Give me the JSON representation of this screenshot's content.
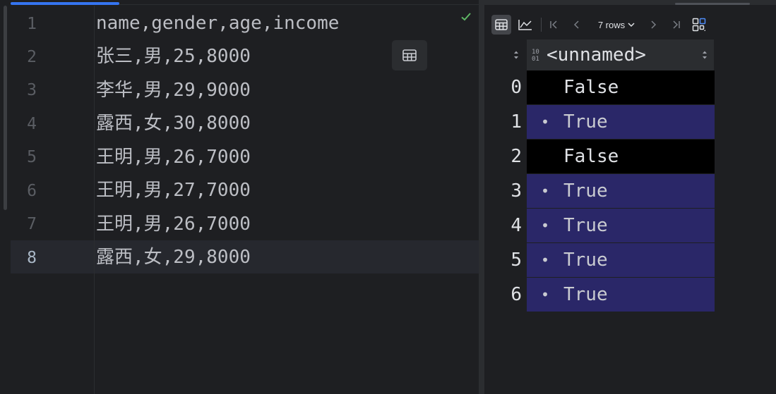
{
  "editor": {
    "line_numbers": [
      "1",
      "2",
      "3",
      "4",
      "5",
      "6",
      "7",
      "8"
    ],
    "lines": [
      "name,gender,age,income",
      "张三,男,25,8000",
      "李华,男,29,9000",
      "露西,女,30,8000",
      "王明,男,26,7000",
      "王明,男,27,7000",
      "王明,男,26,7000",
      "露西,女,29,8000"
    ],
    "active_line": 8
  },
  "viewer": {
    "rows_label": "7 rows",
    "column": {
      "name": "<unnamed>",
      "type_icon_top": "10",
      "type_icon_bottom": "01"
    },
    "rows": [
      {
        "index": "0",
        "value": "False",
        "is_true": false
      },
      {
        "index": "1",
        "value": "True",
        "is_true": true
      },
      {
        "index": "2",
        "value": "False",
        "is_true": false
      },
      {
        "index": "3",
        "value": "True",
        "is_true": true
      },
      {
        "index": "4",
        "value": "True",
        "is_true": true
      },
      {
        "index": "5",
        "value": "True",
        "is_true": true
      },
      {
        "index": "6",
        "value": "True",
        "is_true": true
      }
    ],
    "true_bullet": "•"
  },
  "colors": {
    "background": "#1e1f22",
    "accent": "#3574f0",
    "true_cell": "#2a2768",
    "false_cell": "#000000",
    "check": "#5fb865"
  },
  "icons": [
    "check-icon",
    "table-icon",
    "chart-icon",
    "first-page-icon",
    "prev-page-icon",
    "chevron-down-icon",
    "next-page-icon",
    "last-page-icon",
    "layout-icon",
    "sort-icon",
    "binary-type-icon"
  ]
}
